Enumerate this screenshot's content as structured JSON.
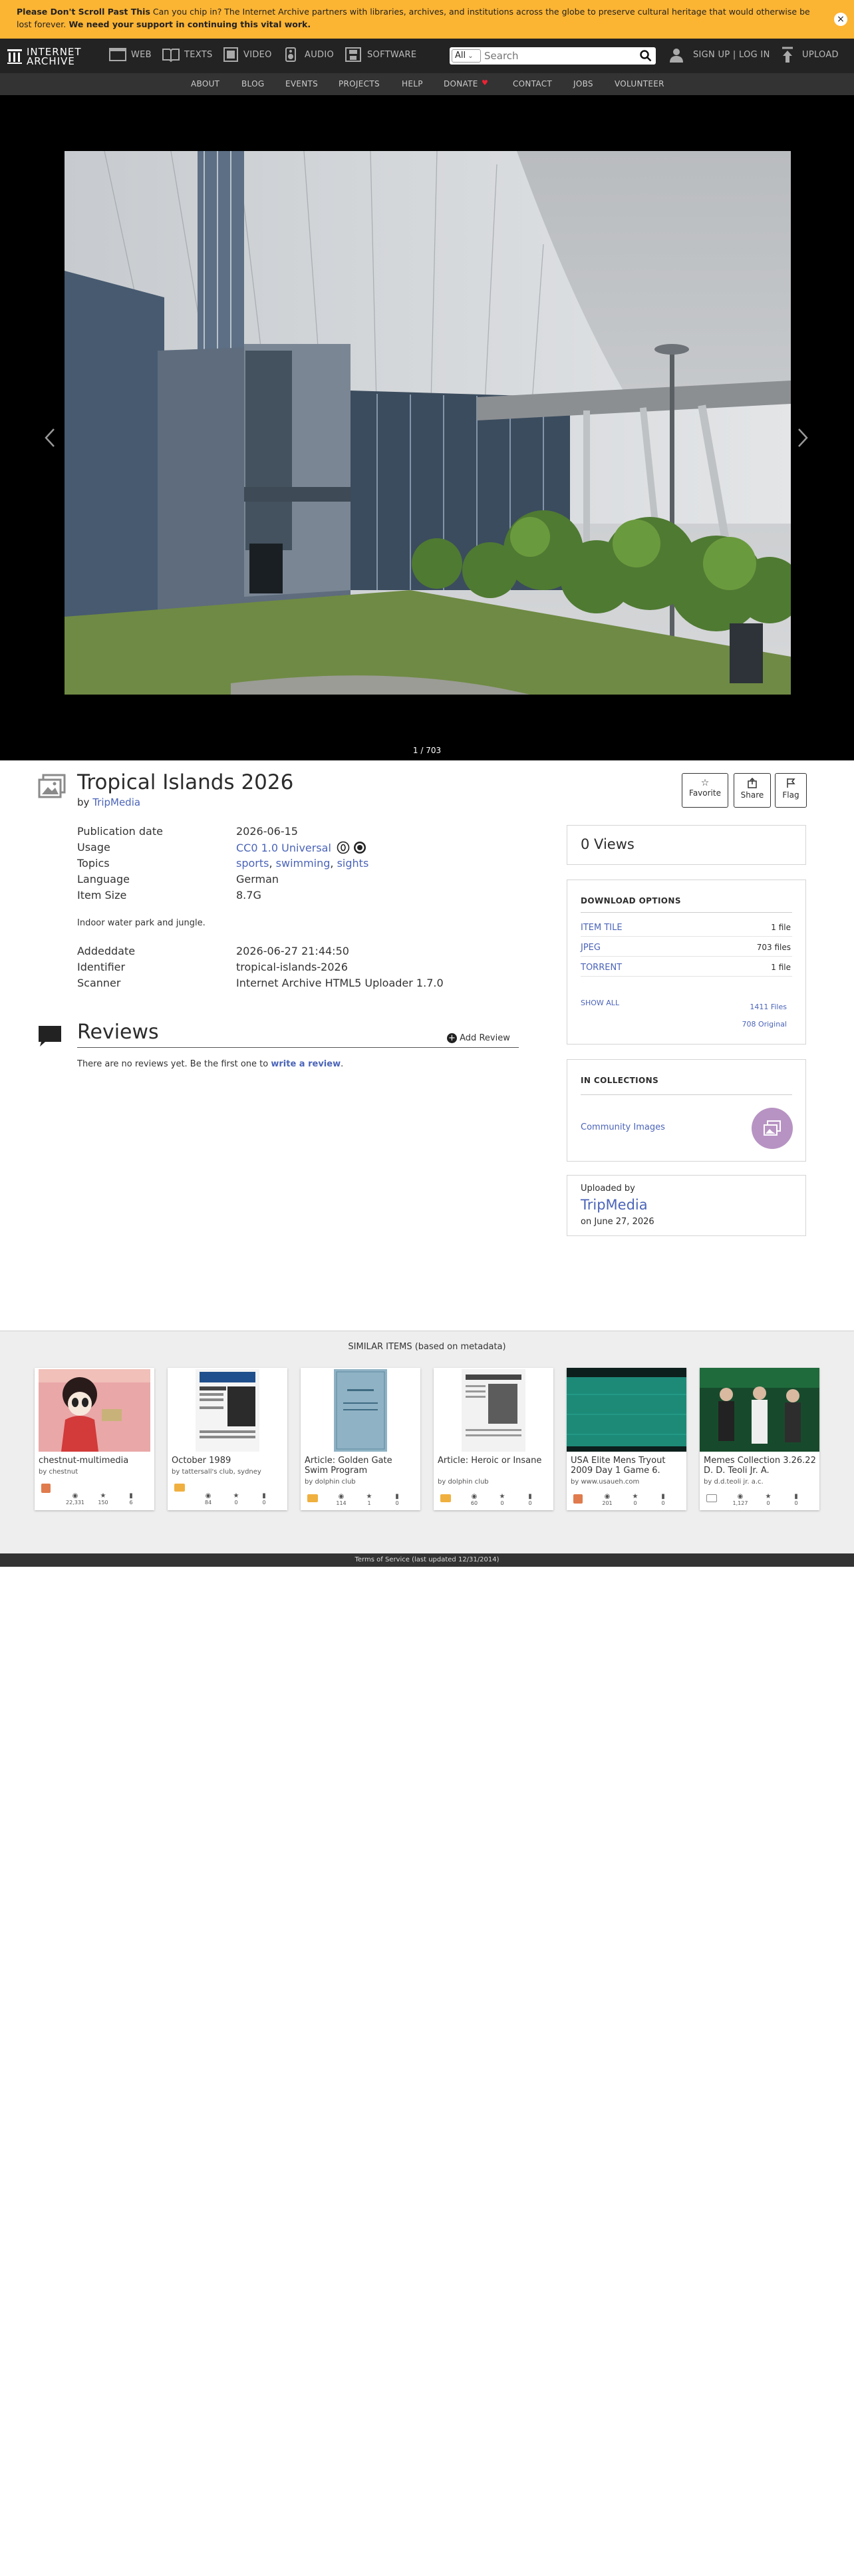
{
  "banner": {
    "strong1": "Please Don't Scroll Past This",
    "text": " Can you chip in? The Internet Archive partners with libraries, archives, and institutions across the globe to preserve cultural heritage that would otherwise be lost forever.",
    "strong2": " We need your support in continuing this vital work.",
    "close": "×"
  },
  "nav": {
    "logo_line1": "INTERNET",
    "logo_line2": "ARCHIVE",
    "items": [
      "WEB",
      "TEXTS",
      "VIDEO",
      "AUDIO",
      "SOFTWARE"
    ],
    "search_scope": "All",
    "search_placeholder": "Search",
    "signin": "SIGN UP | LOG IN",
    "upload": "UPLOAD",
    "sub": [
      "ABOUT",
      "BLOG",
      "EVENTS",
      "PROJECTS",
      "HELP",
      "DONATE",
      "CONTACT",
      "JOBS",
      "VOLUNTEER"
    ]
  },
  "viewer": {
    "counter": "1 / 703"
  },
  "item": {
    "title": "Tropical Islands 2026",
    "by_label": "by",
    "by": "TripMedia",
    "favorite": "Favorite",
    "share": "Share",
    "flag": "Flag",
    "fields": [
      {
        "label": "Publication date",
        "value": "2026-06-15"
      },
      {
        "label": "Usage",
        "value": "CC0 1.0 Universal"
      },
      {
        "label": "Topics",
        "values": [
          "sports",
          "swimming",
          "sights"
        ]
      },
      {
        "label": "Language",
        "value": "German"
      },
      {
        "label": "Item Size",
        "value": "8.7G"
      }
    ],
    "description": "Indoor water park and jungle.",
    "fields2": [
      {
        "label": "Addeddate",
        "value": "2026-06-27 21:44:50"
      },
      {
        "label": "Identifier",
        "value": "tropical-islands-2026"
      },
      {
        "label": "Scanner",
        "value": "Internet Archive HTML5 Uploader 1.7.0"
      }
    ]
  },
  "reviews": {
    "title": "Reviews",
    "add": "Add Review",
    "empty_prefix": "There are no reviews yet. Be the first one to",
    "empty_link": "write a review",
    "empty_suffix": "."
  },
  "side": {
    "views": "0 Views",
    "download_title": "DOWNLOAD OPTIONS",
    "downloads": [
      {
        "name": "ITEM TILE",
        "count": "1 file"
      },
      {
        "name": "JPEG",
        "count": "703 files"
      },
      {
        "name": "TORRENT",
        "count": "1 file"
      }
    ],
    "show_all": "SHOW ALL",
    "total_files": "1411 Files",
    "original": "708 Original",
    "collections_title": "IN COLLECTIONS",
    "collection": "Community Images",
    "uploaded_by_label": "Uploaded by",
    "uploader": "TripMedia",
    "uploaded_on": "on June 27, 2026"
  },
  "similar": {
    "title": "SIMILAR ITEMS (based on metadata)",
    "cards": [
      {
        "title": "chestnut-multimedia",
        "by": "by chestnut",
        "stats": [
          "22,331",
          "150",
          "6"
        ]
      },
      {
        "title": "October 1989",
        "by": "by tattersall's club, sydney",
        "stats": [
          "84",
          "0",
          "0"
        ]
      },
      {
        "title": "Article: Golden Gate Swim Program",
        "by": "by dolphin club",
        "stats": [
          "114",
          "1",
          "0"
        ]
      },
      {
        "title": "Article: Heroic or Insane",
        "by": "by dolphin club",
        "stats": [
          "60",
          "0",
          "0"
        ]
      },
      {
        "title": "USA Elite Mens Tryout 2009 Day 1 Game 6.",
        "by": "by www.usaueh.com",
        "stats": [
          "201",
          "0",
          "0"
        ]
      },
      {
        "title": "Memes Collection 3.26.22 D. D. Teoli Jr. A.",
        "by": "by d.d.teoli jr. a.c.",
        "stats": [
          "1,127",
          "0",
          "0"
        ]
      }
    ]
  },
  "footer": {
    "tos": "Terms of Service (last updated 12/31/2014)"
  },
  "colors": {
    "banner": "#fcb433",
    "nav": "#232323",
    "link": "#4b64b9",
    "collection_icon": "#b793c3"
  }
}
